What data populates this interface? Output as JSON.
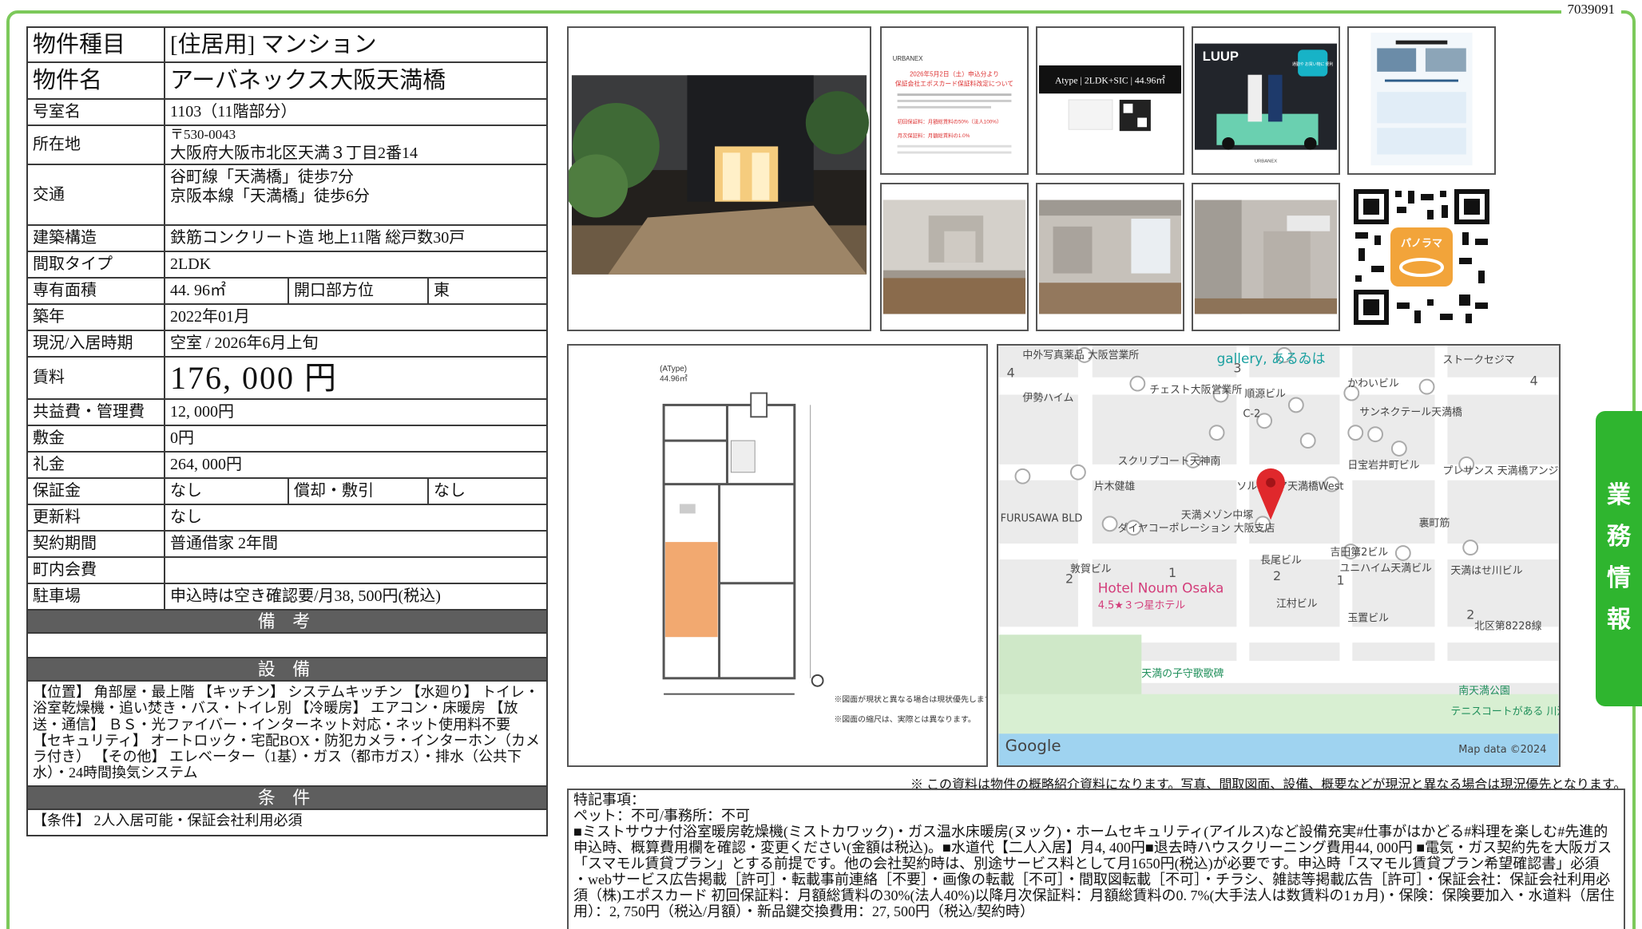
{
  "doc_id": "7039091",
  "spec": {
    "type_label": "物件種目",
    "type_value": "[住居用] マンション",
    "name_label": "物件名",
    "name_value": "アーバネックス大阪天満橋",
    "room_label": "号室名",
    "room_value": "1103（11階部分）",
    "address_label": "所在地",
    "postal": "〒530-0043",
    "address": "大阪府大阪市北区天満３丁目2番14",
    "transport_label": "交通",
    "transport_1": "谷町線「天満橋」徒歩7分",
    "transport_2": "京阪本線「天満橋」徒歩6分",
    "structure_label": "建築構造",
    "structure_value": "鉄筋コンクリート造 地上11階 総戸数30戸",
    "layout_label": "間取タイプ",
    "layout_value": "2LDK",
    "area_label": "専有面積",
    "area_value": "44. 96㎡",
    "direction_label": "開口部方位",
    "direction_value": "東",
    "built_label": "築年",
    "built_value": "2022年01月",
    "status_label": "現況/入居時期",
    "status_value": "空室 / 2026年6月上旬",
    "rent_label": "賃料",
    "rent_value": "176, 000 円",
    "fee_label": "共益費・管理費",
    "fee_value": "12, 000円",
    "deposit_label": "敷金",
    "deposit_value": "0円",
    "key_money_label": "礼金",
    "key_money_value": "264, 000円",
    "guarantee_label": "保証金",
    "guarantee_value": "なし",
    "amort_label": "償却・敷引",
    "amort_value": "なし",
    "renewal_label": "更新料",
    "renewal_value": "なし",
    "contract_label": "契約期間",
    "contract_value": "普通借家 2年間",
    "community_label": "町内会費",
    "community_value": "",
    "parking_label": "駐車場",
    "parking_value": "申込時は空き確認要/月38, 500円(税込)",
    "remarks_header": "備 考",
    "equipment_header": "設 備",
    "equipment_text": "【位置】 角部屋・最上階 【キッチン】 システムキッチン 【水廻り】 トイレ・浴室乾燥機・追い焚き・バス・トイレ別 【冷暖房】 エアコン・床暖房 【放送・通信】 ＢＳ・光ファイバー・インターネット対応・ネット使用料不要 【セキュリティ】 オートロック・宅配BOX・防犯カメラ・インターホン（カメラ付き） 【その他】 エレベーター（1基）・ガス（都市ガス）・排水（公共下水）・24時間換気システム",
    "conditions_header": "条 件",
    "conditions_text": "【条件】 2人入居可能・保証会社利用必須"
  },
  "flyers": {
    "urbanex_brand": "URBANEX",
    "notice_line1": "2026年5月2日（土）申込分より",
    "notice_line2": "保証会社エポスカード保証料改定について",
    "notice_line3": "初回保証料：月額総賃料の50%（法人100%）",
    "notice_line4": "月次保証料：月額総賃料の1.0%",
    "type_card": "Atype | 2LDK+SIC | 44.96㎡",
    "luup_brand": "LUUP",
    "luup_bubble": "通勤や お買い物に 便利",
    "panorama_label": "パノラマ"
  },
  "floorplan": {
    "type_label": "(AType)",
    "area_label": "44.96㎡",
    "note1": "※図面が現状と異なる場合は現状優先します。",
    "note2": "※図面の縮尺は、実際とは異なります。"
  },
  "map": {
    "labels": [
      "中外写真薬品 大阪営業所",
      "gallery, あるゐは",
      "ストークセジマ",
      "伊勢ハイム",
      "チェスト大阪営業所",
      "順源ビル",
      "かわいビル",
      "C-2",
      "サンネクテール天満橋",
      "スクリプコート天神南",
      "日宝岩井町ビル",
      "片木健雄",
      "ソルティア天満橋West",
      "プレサンス 天満橋アンジェ",
      "FURUSAWA BLD",
      "天満メゾン中塚",
      "ダイヤコーポレーション 大阪支店",
      "裏町筋",
      "吉田第2ビル",
      "敦賀ビル",
      "長尾ビル",
      "ユニハイム天満ビル",
      "天満はせ川ビル",
      "Hotel Noum Osaka",
      "4.5★３つ星ホテル",
      "江村ビル",
      "玉置ビル",
      "北区第8228線",
      "天満の子守歌歌碑",
      "南天満公園",
      "テニスコートがある 川沿いのエリア",
      "Google",
      "Map data ©2024"
    ],
    "block_numbers": [
      "4",
      "3",
      "4",
      "2",
      "1",
      "2",
      "1",
      "2"
    ]
  },
  "side_tab_chars": [
    "業",
    "務",
    "情",
    "報"
  ],
  "disclaimer": "※ この資料は物件の概略紹介資料になります。写真、間取図面、設備、概要などが現況と異なる場合は現況優先となります。",
  "remarks": {
    "title": "特記事項：",
    "line1": "ペット：不可/事務所：不可",
    "line2": "■ミストサウナ付浴室暖房乾燥機(ミストカワック)・ガス温水床暖房(ヌック)・ホームセキュリティ(アイルス)など設備充実#仕事がはかどる#料理を楽しむ#先進的 申込時、概算費用欄を確認・変更ください(金額は税込)。■水道代【二人入居】月4, 400円■退去時ハウスクリーニング費用44, 000円 ■電気・ガス契約先を大阪ガス「スマモル賃貸プラン」とする前提です。他の会社契約時は、別途サービス料として月1650円(税込)が必要です。申込時「スマモル賃貸プラン希望確認書」必須",
    "line3": "・webサービス広告掲載［許可］・転載事前連絡［不要］・画像の転載［不可］・間取図転載［不可］・チラシ、雑誌等掲載広告［許可］・保証会社：保証会社利用必須（株)エポスカード 初回保証料：月額総賃料の30%(法人40%)以降月次保証料：月額総賃料の0. 7%(大手法人は数賃料の1ヵ月)・保険：保険要加入・水道料（居住用）：2, 750円（税込/月額）・新品鍵交換費用：27, 500円（税込/契約時）"
  },
  "colors": {
    "frame_green": "#7cc95a",
    "tab_green": "#2fb52f",
    "header_gray": "#5e5e5e",
    "pin_red": "#e0282c"
  }
}
